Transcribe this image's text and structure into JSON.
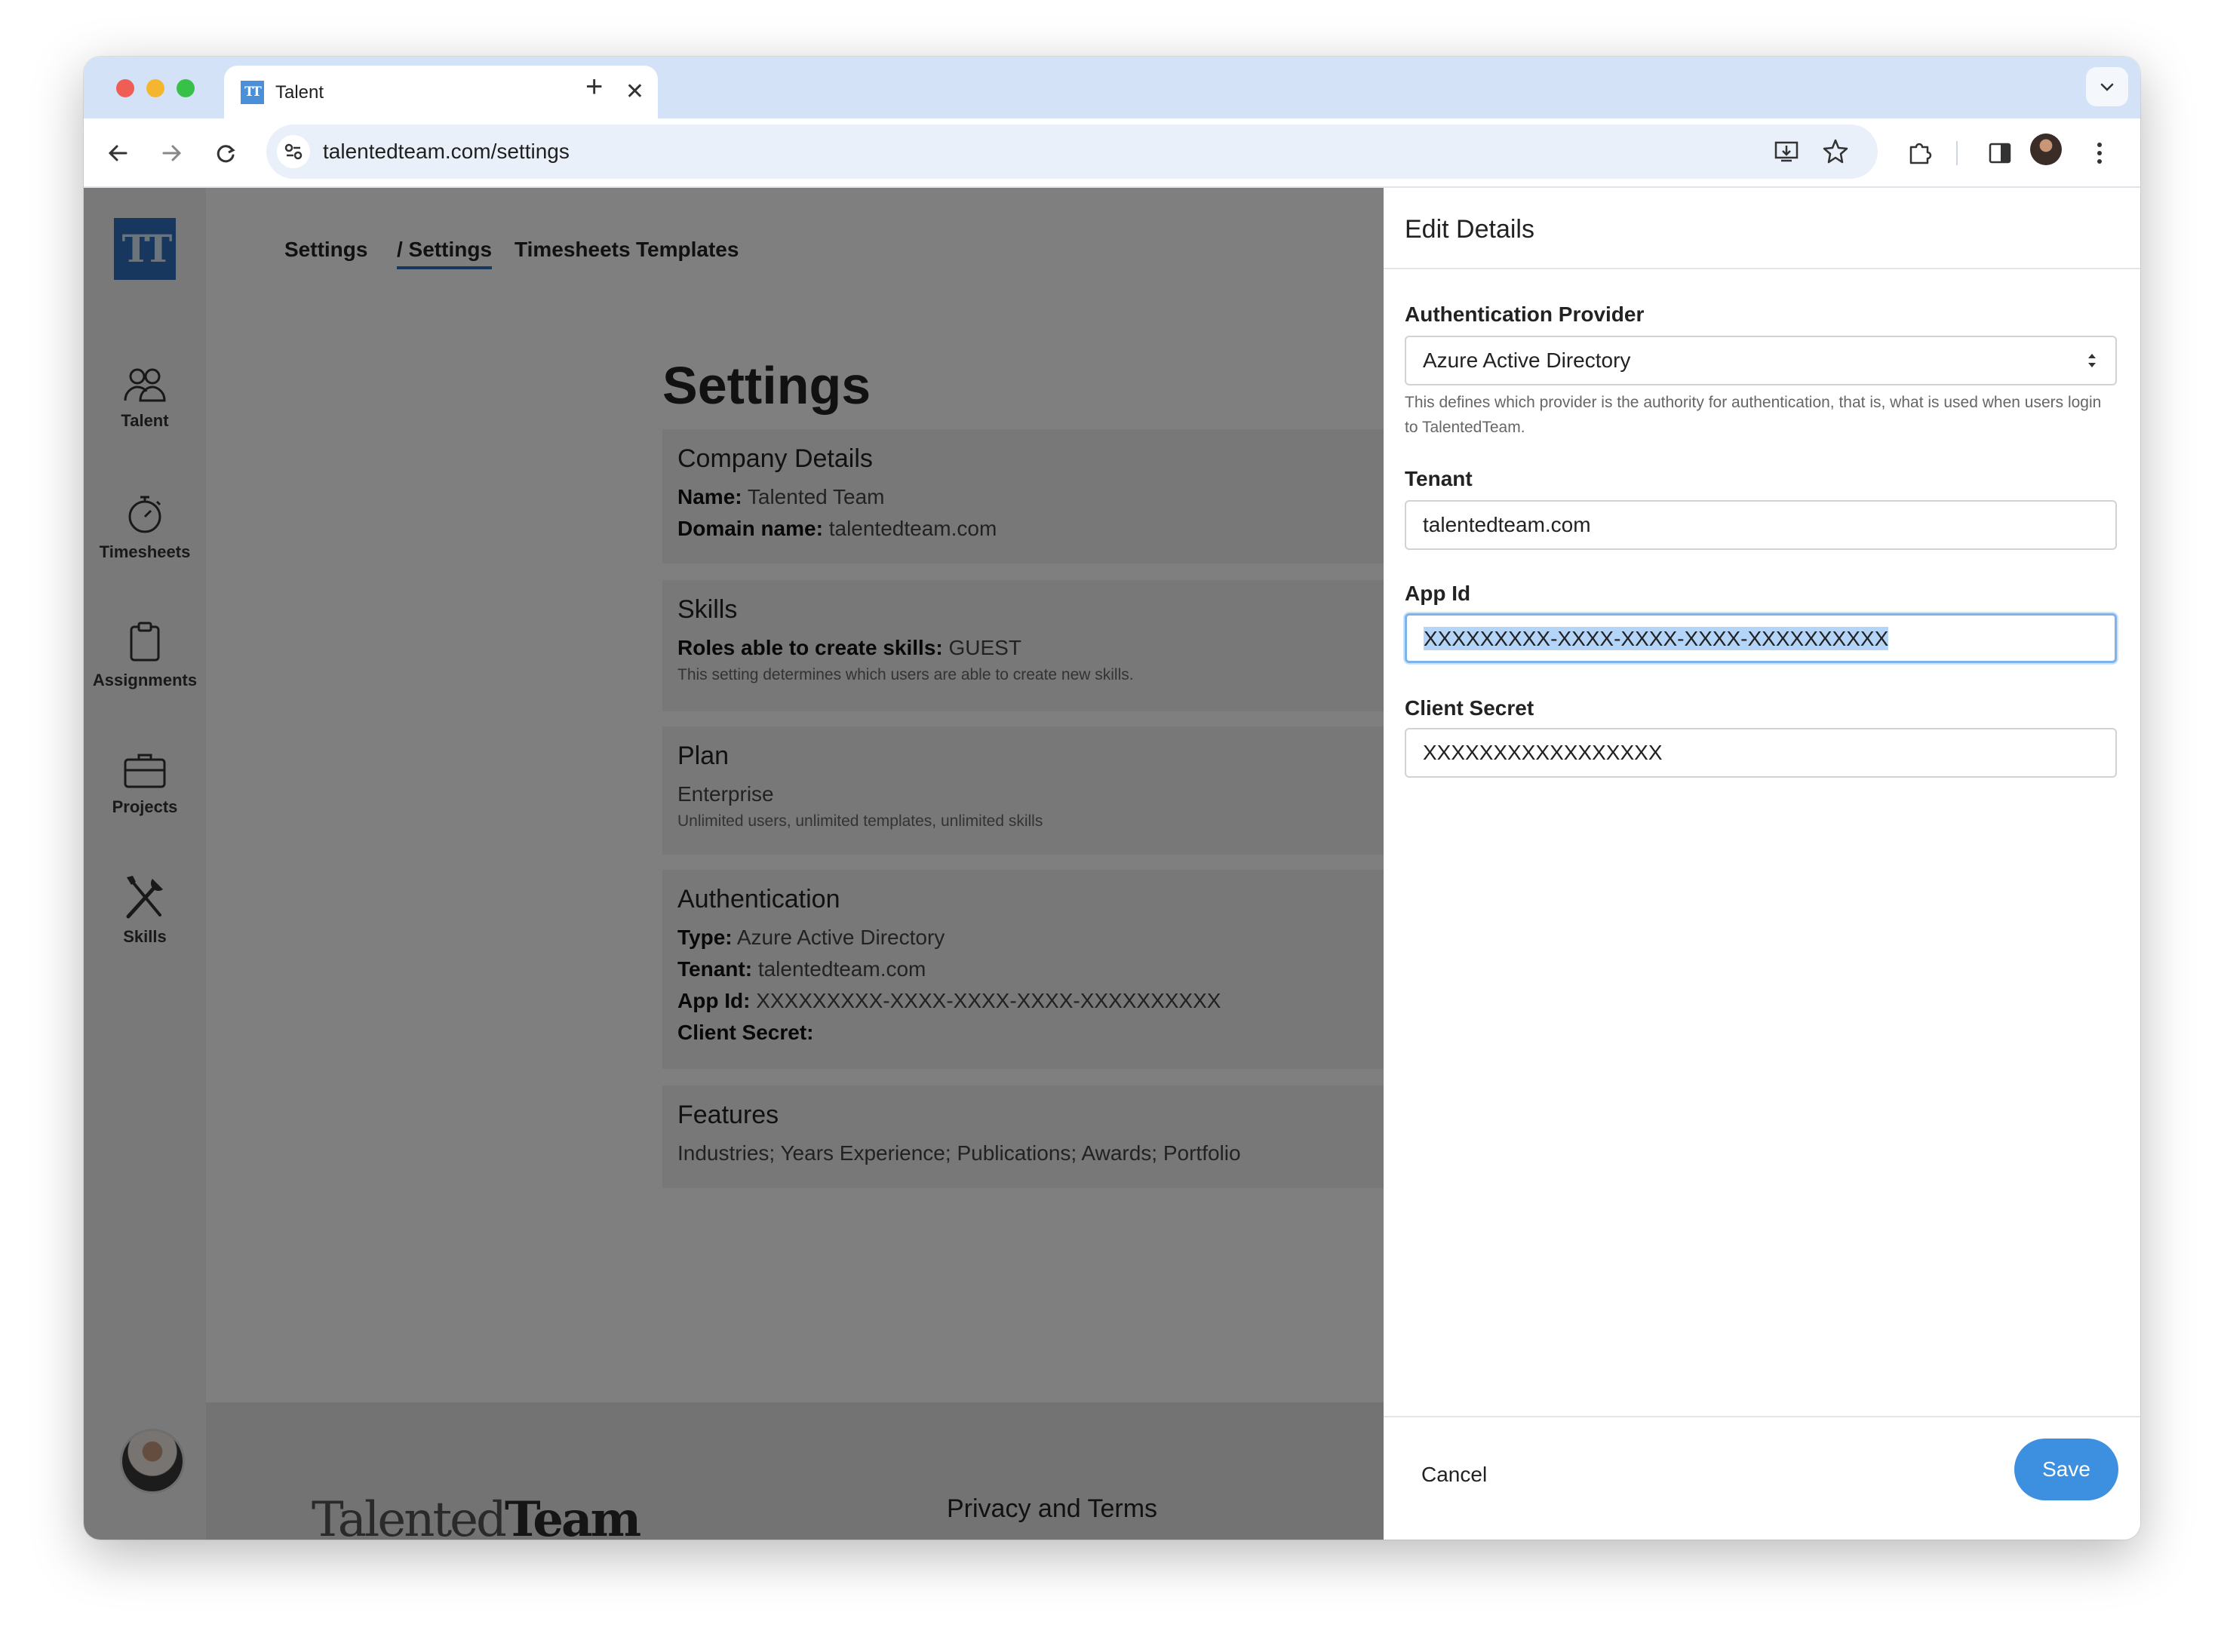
{
  "browser": {
    "tab_title": "Talent",
    "tab_favicon_text": "TT",
    "url": "talentedteam.com/settings"
  },
  "sidebar": {
    "logo_text": "TT",
    "items": [
      {
        "label": "Talent",
        "icon": "people-icon"
      },
      {
        "label": "Timesheets",
        "icon": "stopwatch-icon"
      },
      {
        "label": "Assignments",
        "icon": "clipboard-icon"
      },
      {
        "label": "Projects",
        "icon": "briefcase-icon"
      },
      {
        "label": "Skills",
        "icon": "tools-icon"
      }
    ]
  },
  "topnav": {
    "items": [
      "Settings",
      "/ Settings",
      "Timesheets",
      "Templates"
    ],
    "active_index": 1
  },
  "page": {
    "title": "Settings",
    "company": {
      "heading": "Company Details",
      "name_label": "Name:",
      "name_value": "Talented Team",
      "domain_label": "Domain name:",
      "domain_value": "talentedteam.com"
    },
    "skills": {
      "heading": "Skills",
      "roles_label": "Roles able to create skills:",
      "roles_value": "GUEST",
      "hint": "This setting determines which users are able to create new skills."
    },
    "plan": {
      "heading": "Plan",
      "name": "Enterprise",
      "hint": "Unlimited users, unlimited templates, unlimited skills"
    },
    "authentication": {
      "heading": "Authentication",
      "type_label": "Type:",
      "type_value": "Azure Active Directory",
      "tenant_label": "Tenant:",
      "tenant_value": "talentedteam.com",
      "appid_label": "App Id:",
      "appid_value": "XXXXXXXXX-XXXX-XXXX-XXXX-XXXXXXXXXX",
      "secret_label": "Client Secret:"
    },
    "features": {
      "heading": "Features",
      "list": "Industries; Years Experience; Publications; Awards; Portfolio"
    }
  },
  "footer": {
    "logo_left": "Talented",
    "logo_right": "Team",
    "links_heading": "Privacy and Terms"
  },
  "drawer": {
    "title": "Edit Details",
    "provider_label": "Authentication Provider",
    "provider_value": "Azure Active Directory",
    "provider_help": "This defines which provider is the authority for authentication, that is, what is used when users login to TalentedTeam.",
    "tenant_label": "Tenant",
    "tenant_value": "talentedteam.com",
    "appid_label": "App Id",
    "appid_value": "XXXXXXXXX-XXXX-XXXX-XXXX-XXXXXXXXXX",
    "secret_label": "Client Secret",
    "secret_value": "XXXXXXXXXXXXXXXXX",
    "cancel_label": "Cancel",
    "save_label": "Save"
  },
  "colors": {
    "accent": "#3d8fe0",
    "brand": "#2f6fbd",
    "tabstrip": "#d4e2f8",
    "selection": "#b4d4f8"
  }
}
